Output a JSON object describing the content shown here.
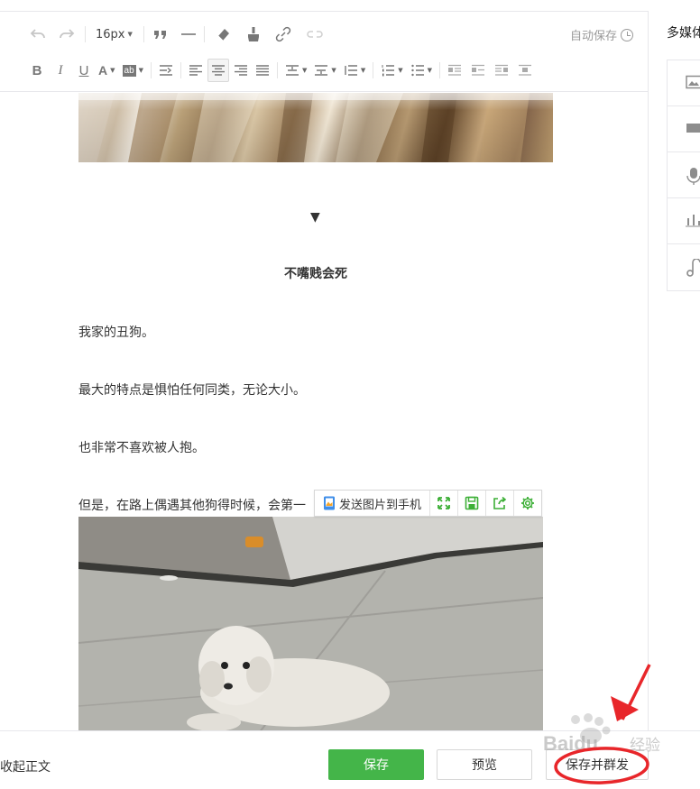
{
  "toolbar": {
    "font_size": "16px",
    "auto_save": "自动保存"
  },
  "side_panel": {
    "title": "多媒体"
  },
  "article": {
    "heading": "不嘴贱会死",
    "paragraphs": [
      "我家的丑狗。",
      "最大的特点是惧怕任何同类，无论大小。",
      "也非常不喜欢被人抱。",
      "但是，在路上偶遇其他狗得时候，会第一"
    ],
    "separator_glyph": "▼"
  },
  "image_toolbar": {
    "send_to_phone": "发送图片到手机"
  },
  "bottom_bar": {
    "collapse": "收起正文",
    "save": "保存",
    "preview": "预览",
    "save_and_publish": "保存并群发"
  },
  "watermark": {
    "brand": "Baidu",
    "suffix": "经验"
  },
  "colors": {
    "primary_green": "#44b549",
    "annotation_red": "#e8262a",
    "icon_green": "#3caf36"
  },
  "icons": {
    "undo": "undo-icon",
    "redo": "redo-icon",
    "quote": "quote-icon",
    "hr": "horizontal-rule-icon",
    "eraser": "eraser-icon",
    "format_brush": "format-brush-icon",
    "link": "link-icon",
    "unlink": "unlink-icon",
    "image": "image-icon",
    "video": "video-icon",
    "audio": "microphone-icon",
    "vote": "bar-chart-icon",
    "music": "music-note-icon",
    "fullscreen": "expand-icon",
    "save_img": "floppy-icon",
    "share": "share-icon",
    "settings": "gear-icon",
    "phone": "phone-image-icon"
  }
}
